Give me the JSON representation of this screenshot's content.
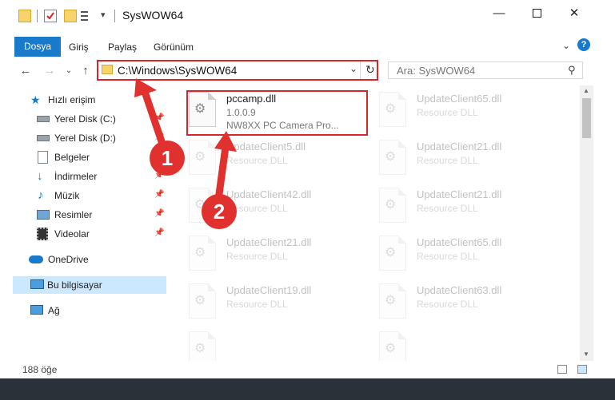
{
  "window": {
    "title": "SysWOW64",
    "minimize_icon": "minimize-icon",
    "maximize_icon": "maximize-icon",
    "close_icon": "close-icon"
  },
  "ribbon": {
    "tabs": [
      {
        "label": "Dosya",
        "active": true
      },
      {
        "label": "Giriş"
      },
      {
        "label": "Paylaş"
      },
      {
        "label": "Görünüm"
      }
    ]
  },
  "address": {
    "path": "C:\\Windows\\SysWOW64",
    "search_placeholder": "Ara: SysWOW64"
  },
  "sidebar": {
    "items": [
      {
        "label": "Hızlı erişim",
        "icon": "star-icon"
      },
      {
        "label": "Yerel Disk (C:)",
        "icon": "drive-icon",
        "pinned": true
      },
      {
        "label": "Yerel Disk (D:)",
        "icon": "drive-icon",
        "pinned": true
      },
      {
        "label": "Belgeler",
        "icon": "documents-icon",
        "pinned": true
      },
      {
        "label": "İndirmeler",
        "icon": "download-icon",
        "pinned": true
      },
      {
        "label": "Müzik",
        "icon": "music-icon",
        "pinned": true
      },
      {
        "label": "Resimler",
        "icon": "pictures-icon",
        "pinned": true
      },
      {
        "label": "Videolar",
        "icon": "videos-icon",
        "pinned": true
      },
      {
        "label": "OneDrive",
        "icon": "cloud-icon"
      },
      {
        "label": "Bu bilgisayar",
        "icon": "computer-icon",
        "selected": true
      },
      {
        "label": "Ağ",
        "icon": "network-icon"
      }
    ]
  },
  "files": [
    {
      "name": "pccamp.dll",
      "version": "1.0.0.9",
      "description": "NW8XX PC Camera Pro...",
      "highlighted": true
    },
    {
      "name": "UpdateClient65.dll",
      "description": "Resource DLL"
    },
    {
      "name": "UpdateClient5.dll",
      "description": "Resource DLL"
    },
    {
      "name": "UpdateClient21.dll",
      "description": "Resource DLL"
    },
    {
      "name": "UpdateClient42.dll",
      "description": "Resource DLL"
    },
    {
      "name": "UpdateClient21.dll",
      "description": "Resource DLL"
    },
    {
      "name": "UpdateClient21.dll",
      "description": "Resource DLL"
    },
    {
      "name": "UpdateClient65.dll",
      "description": "Resource DLL"
    },
    {
      "name": "UpdateClient19.dll",
      "description": "Resource DLL"
    },
    {
      "name": "UpdateClient63.dll",
      "description": "Resource DLL"
    }
  ],
  "status": {
    "item_count": "188 öğe"
  },
  "annotations": {
    "step1": "1",
    "step2": "2",
    "color": "#e0312f"
  }
}
